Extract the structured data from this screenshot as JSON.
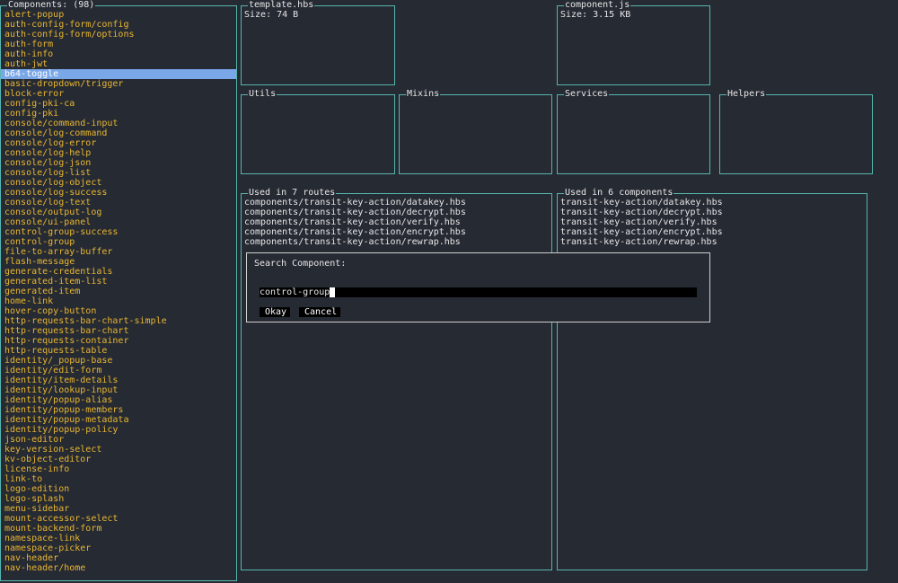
{
  "components_panel": {
    "title": "Components: (98)",
    "items": [
      "alert-popup",
      "auth-config-form/config",
      "auth-config-form/options",
      "auth-form",
      "auth-info",
      "auth-jwt",
      "b64-toggle",
      "basic-dropdown/trigger",
      "block-error",
      "config-pki-ca",
      "config-pki",
      "console/command-input",
      "console/log-command",
      "console/log-error",
      "console/log-help",
      "console/log-json",
      "console/log-list",
      "console/log-object",
      "console/log-success",
      "console/log-text",
      "console/output-log",
      "console/ui-panel",
      "control-group-success",
      "control-group",
      "file-to-array-buffer",
      "flash-message",
      "generate-credentials",
      "generated-item-list",
      "generated-item",
      "home-link",
      "hover-copy-button",
      "http-requests-bar-chart-simple",
      "http-requests-bar-chart",
      "http-requests-container",
      "http-requests-table",
      "identity/_popup-base",
      "identity/edit-form",
      "identity/item-details",
      "identity/lookup-input",
      "identity/popup-alias",
      "identity/popup-members",
      "identity/popup-metadata",
      "identity/popup-policy",
      "json-editor",
      "key-version-select",
      "kv-object-editor",
      "license-info",
      "link-to",
      "logo-edition",
      "logo-splash",
      "menu-sidebar",
      "mount-accessor-select",
      "mount-backend-form",
      "namespace-link",
      "namespace-picker",
      "nav-header",
      "nav-header/home"
    ],
    "selected_index": 6
  },
  "template_panel": {
    "title": "template.hbs",
    "size": "Size: 74 B"
  },
  "component_panel": {
    "title": "component.js",
    "size": "Size: 3.15 KB"
  },
  "utils_panel": {
    "title": "Utils"
  },
  "mixins_panel": {
    "title": "Mixins"
  },
  "services_panel": {
    "title": "Services"
  },
  "helpers_panel": {
    "title": "Helpers"
  },
  "routes_panel": {
    "title": "Used in 7 routes",
    "items": [
      "components/transit-key-action/datakey.hbs",
      "components/transit-key-action/decrypt.hbs",
      "components/transit-key-action/verify.hbs",
      "components/transit-key-action/encrypt.hbs",
      "components/transit-key-action/rewrap.hbs"
    ]
  },
  "used_components_panel": {
    "title": "Used in 6 components",
    "items": [
      "transit-key-action/datakey.hbs",
      "transit-key-action/decrypt.hbs",
      "transit-key-action/verify.hbs",
      "transit-key-action/encrypt.hbs",
      "transit-key-action/rewrap.hbs"
    ]
  },
  "search_dialog": {
    "label": "Search Component:",
    "value": "control-group",
    "okay_label": "Okay",
    "cancel_label": "Cancel"
  },
  "colors": {
    "background": "#262a33",
    "border": "#56b6b0",
    "list_text": "#e8b630",
    "selection": "#7aa7e8",
    "dialog_border": "#cfcfcf"
  }
}
